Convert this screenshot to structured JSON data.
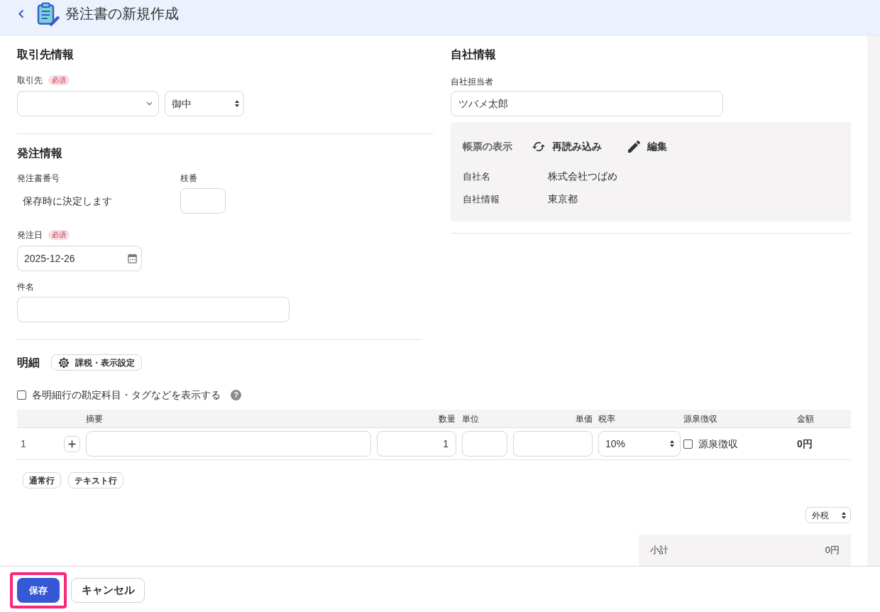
{
  "header": {
    "title": "発注書の新規作成"
  },
  "client_info": {
    "heading": "取引先情報",
    "client": {
      "label": "取引先",
      "badge": "必須"
    },
    "honorific": {
      "value": "御中"
    }
  },
  "order_info": {
    "heading": "発注情報",
    "order_number": {
      "label": "発注書番号",
      "value": "保存時に決定します"
    },
    "branch_number": {
      "label": "枝番"
    },
    "order_date": {
      "label": "発注日",
      "badge": "必須",
      "value": "2025-12-26"
    },
    "subject": {
      "label": "件名"
    }
  },
  "company_info": {
    "heading": "自社情報",
    "staff": {
      "label": "自社担当者",
      "value": "ツバメ太郎"
    },
    "document_display": {
      "heading": "帳票の表示",
      "actions": [
        {
          "label": "再読み込み",
          "kind": "reload"
        },
        {
          "label": "編集",
          "kind": "edit"
        }
      ],
      "rows": [
        {
          "label": "自社名",
          "value": "株式会社つばめ"
        },
        {
          "label": "自社情報",
          "value": "東京都"
        }
      ]
    }
  },
  "details": {
    "heading": "明細",
    "settings_button": "課税・表示設定",
    "show_accounts": {
      "label": "各明細行の勘定科目・タグなどを表示する",
      "checked": false,
      "help": "?"
    },
    "table": {
      "columns": [
        "摘要",
        "数量",
        "単位",
        "単価",
        "税率",
        "源泉徴収",
        "金額"
      ],
      "rows": [
        {
          "number": "1",
          "quantity": "1",
          "tax_rate": "10%",
          "withholding": {
            "label": "源泉徴収",
            "checked": false
          },
          "amount": "0円"
        }
      ]
    },
    "add_buttons": [
      "通常行",
      "テキスト行"
    ],
    "tax_mode": {
      "value": "外税"
    },
    "summary": [
      {
        "label": "小計",
        "value": "0円"
      }
    ]
  },
  "footer": {
    "buttons": [
      {
        "label": "保存",
        "kind": "primary",
        "highlighted": true
      },
      {
        "label": "キャンセル",
        "kind": "secondary",
        "highlighted": false
      }
    ]
  }
}
